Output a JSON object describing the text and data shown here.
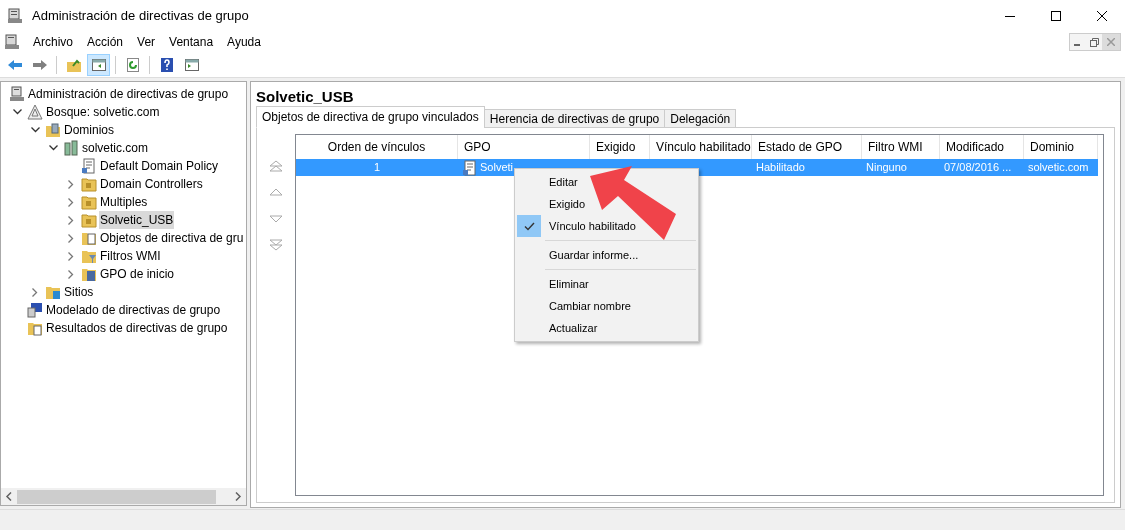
{
  "window": {
    "title": "Administración de directivas de grupo"
  },
  "menu": [
    "Archivo",
    "Acción",
    "Ver",
    "Ventana",
    "Ayuda"
  ],
  "toolbar": [
    {
      "kind": "back",
      "pressed": false
    },
    {
      "kind": "forward",
      "pressed": false
    },
    {
      "kind": "separator"
    },
    {
      "kind": "up",
      "pressed": false
    },
    {
      "kind": "pane",
      "pressed": true
    },
    {
      "kind": "separator"
    },
    {
      "kind": "refresh",
      "pressed": false
    },
    {
      "kind": "separator"
    },
    {
      "kind": "help",
      "pressed": false
    },
    {
      "kind": "view",
      "pressed": false
    }
  ],
  "tree": [
    {
      "label": "Administración de directivas de grupo",
      "kind": "console",
      "selected": false,
      "children": [
        {
          "label": "Bosque: solvetic.com",
          "kind": "forest",
          "selected": false,
          "expanded": true,
          "children": [
            {
              "label": "Dominios",
              "kind": "domains",
              "selected": false,
              "expanded": true,
              "children": [
                {
                  "label": "solvetic.com",
                  "kind": "domain",
                  "selected": false,
                  "expanded": true,
                  "children": [
                    {
                      "label": "Default Domain Policy",
                      "kind": "gpo",
                      "selected": false
                    },
                    {
                      "label": "Domain Controllers",
                      "kind": "ou",
                      "selected": false,
                      "expanded": false
                    },
                    {
                      "label": "Multiples",
                      "kind": "ou",
                      "selected": false,
                      "expanded": false
                    },
                    {
                      "label": "Solvetic_USB",
                      "kind": "ou",
                      "selected": true,
                      "expanded": false
                    },
                    {
                      "label": "Objetos de directiva de gru",
                      "kind": "gpos",
                      "selected": false,
                      "expanded": false
                    },
                    {
                      "label": "Filtros WMI",
                      "kind": "wmi",
                      "selected": false,
                      "expanded": false
                    },
                    {
                      "label": "GPO de inicio",
                      "kind": "starter",
                      "selected": false,
                      "expanded": false
                    }
                  ]
                }
              ]
            },
            {
              "label": "Sitios",
              "kind": "sites",
              "selected": false,
              "expanded": false
            }
          ]
        },
        {
          "label": "Modelado de directivas de grupo",
          "kind": "modeling",
          "selected": false
        },
        {
          "label": "Resultados de directivas de grupo",
          "kind": "results",
          "selected": false
        }
      ]
    }
  ],
  "pane": {
    "title": "Solvetic_USB",
    "tabs": [
      {
        "label": "Objetos de directiva de grupo vinculados",
        "selected": true
      },
      {
        "label": "Herencia de directivas de grupo",
        "selected": false
      },
      {
        "label": "Delegación",
        "selected": false
      }
    ],
    "columns": [
      "Orden de vínculos",
      "GPO",
      "Exigido",
      "Vínculo habilitado",
      "Estado de GPO",
      "Filtro WMI",
      "Modificado",
      "Dominio"
    ],
    "rows": [
      {
        "selected": true,
        "cells": [
          "1",
          "Solveti",
          "",
          "",
          "Habilitado",
          "Ninguno",
          "07/08/2016 ...",
          "solvetic.com"
        ]
      }
    ]
  },
  "context_menu": [
    {
      "kind": "item",
      "label": "Editar",
      "checked": false
    },
    {
      "kind": "item",
      "label": "Exigido",
      "checked": false
    },
    {
      "kind": "item",
      "label": "Vínculo habilitado",
      "checked": true
    },
    {
      "kind": "separator"
    },
    {
      "kind": "item",
      "label": "Guardar informe...",
      "checked": false
    },
    {
      "kind": "separator"
    },
    {
      "kind": "item",
      "label": "Eliminar",
      "checked": false
    },
    {
      "kind": "item",
      "label": "Cambiar nombre",
      "checked": false
    },
    {
      "kind": "item",
      "label": "Actualizar",
      "checked": false
    }
  ]
}
